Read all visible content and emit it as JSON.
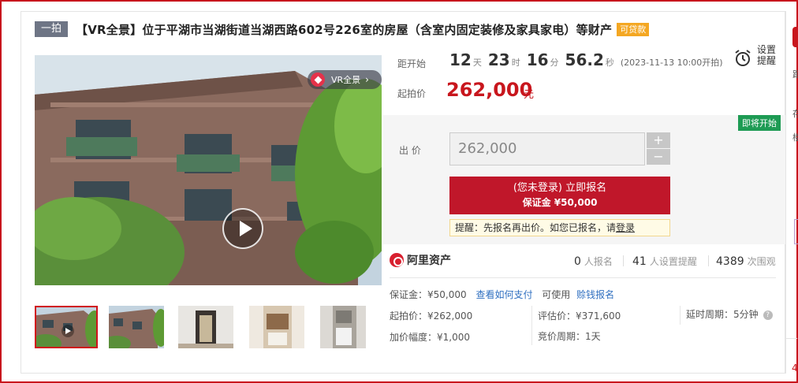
{
  "lot": {
    "type_tag": "一拍",
    "title": "【VR全景】位于平湖市当湖街道当湖西路602号226室的房屋（含室内固定装修及家具家电）等财产",
    "loan_tag": "可贷款"
  },
  "media": {
    "vr_label": "VR全景",
    "thumbnail_count": 5,
    "selected_thumbnail": 1
  },
  "countdown": {
    "label": "距开始",
    "days": "12",
    "days_unit": "天",
    "hours": "23",
    "hours_unit": "时",
    "minutes": "16",
    "minutes_unit": "分",
    "seconds": "56.2",
    "seconds_unit": "秒",
    "start_time": "(2023-11-13 10:00开拍)"
  },
  "reminder": {
    "label": "设置提醒"
  },
  "starting_price": {
    "label": "起拍价",
    "value": "262,000",
    "unit": "元"
  },
  "bid": {
    "status_badge": "即将开始",
    "label": "出 价",
    "input_value": "262,000",
    "plus": "+",
    "minus": "−",
    "signup_line1": "(您未登录) 立即报名",
    "signup_line2": "保证金 ¥50,000",
    "tip_text": "提醒：先报名再出价。如您已报名，请",
    "tip_link": "登录"
  },
  "platform": {
    "name": "阿里资产"
  },
  "stats": {
    "signups": "0",
    "signups_label": "人报名",
    "reminders": "41",
    "reminders_label": "人设置提醒",
    "views": "4389",
    "views_label": "次围观"
  },
  "details": {
    "deposit": "保证金：¥50,000",
    "how_to_pay": "查看如何支付",
    "available": "可使用",
    "credit_signup": "赊钱报名",
    "start_price": "起拍价：¥262,000",
    "appraisal": "评估价：¥371,600",
    "delay_period": "延时周期：5分钟",
    "increment": "加价幅度：¥1,000",
    "bid_period": "竞价周期：1天"
  },
  "colors": {
    "accent": "#c8161d",
    "green": "#1e9b54",
    "tag_orange": "#f4a722",
    "link": "#2f6fc0"
  }
}
